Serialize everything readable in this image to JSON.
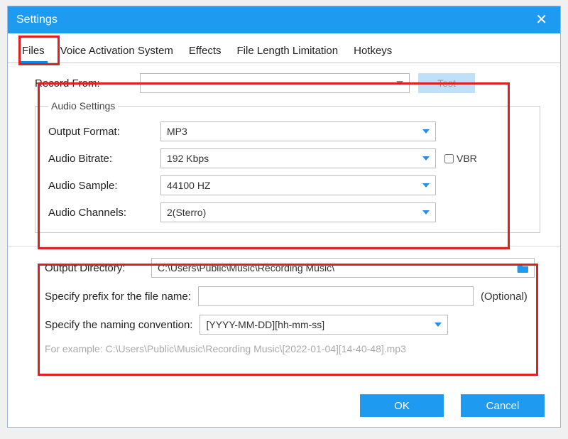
{
  "window": {
    "title": "Settings"
  },
  "tabs": {
    "files": "Files",
    "voice": "Voice Activation System",
    "effects": "Effects",
    "file_length": "File Length Limitation",
    "hotkeys": "Hotkeys"
  },
  "record_from": {
    "label": "Record  From:",
    "value": "",
    "test": "Test"
  },
  "audio_settings": {
    "legend": "Audio Settings",
    "output_format": {
      "label": "Output Format:",
      "value": "MP3"
    },
    "audio_bitrate": {
      "label": "Audio Bitrate:",
      "value": "192 Kbps",
      "vbr_label": "VBR",
      "vbr_checked": false
    },
    "audio_sample": {
      "label": "Audio Sample:",
      "value": "44100 HZ"
    },
    "audio_channels": {
      "label": "Audio Channels:",
      "value": "2(Sterro)"
    }
  },
  "output": {
    "dir_label": "Output Directory:",
    "dir_value": "C:\\Users\\Public\\Music\\Recording Music\\",
    "prefix_label": "Specify prefix for the file name:",
    "prefix_value": "",
    "optional": "(Optional)",
    "convention_label": "Specify the naming convention:",
    "convention_value": "[YYYY-MM-DD][hh-mm-ss]",
    "example": "For example: C:\\Users\\Public\\Music\\Recording Music\\[2022-01-04][14-40-48].mp3"
  },
  "buttons": {
    "ok": "OK",
    "cancel": "Cancel"
  }
}
